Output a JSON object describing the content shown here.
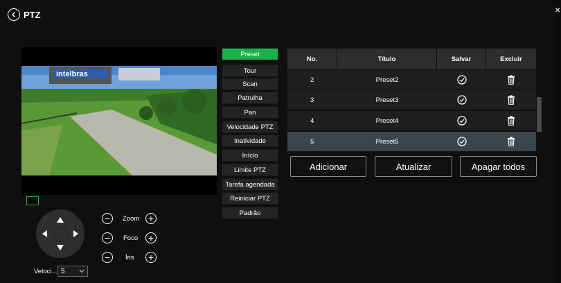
{
  "header": {
    "title": "PTZ",
    "close": "×"
  },
  "image_text": {
    "logo": "intelbras"
  },
  "ptz_menu": [
    {
      "label": "Preset",
      "active": true
    },
    {
      "label": "Tour"
    },
    {
      "label": "Scan"
    },
    {
      "label": "Patrulha"
    },
    {
      "label": "Pan"
    },
    {
      "label": "Velocidade PTZ"
    },
    {
      "label": "Inatividade"
    },
    {
      "label": "Início"
    },
    {
      "label": "Limite PTZ"
    },
    {
      "label": "Tarefa agendada"
    },
    {
      "label": "Reiniciar PTZ"
    },
    {
      "label": "Padrão"
    }
  ],
  "table": {
    "headers": [
      "No.",
      "Título",
      "Salvar",
      "Excluir"
    ],
    "rows": [
      {
        "no": "2",
        "title": "Preset2"
      },
      {
        "no": "3",
        "title": "Preset3"
      },
      {
        "no": "4",
        "title": "Preset4"
      },
      {
        "no": "5",
        "title": "Preset5",
        "selected": true
      }
    ]
  },
  "actions": {
    "add": "Adicionar",
    "refresh": "Atualizar",
    "delete_all": "Apagar todos"
  },
  "controls": {
    "zoom": "Zoom",
    "focus": "Foco",
    "iris": "Íris",
    "speed_label": "Veloci...",
    "speed_value": "5"
  },
  "colors": {
    "accent": "#1bb14a",
    "selected_row": "#39474d"
  }
}
